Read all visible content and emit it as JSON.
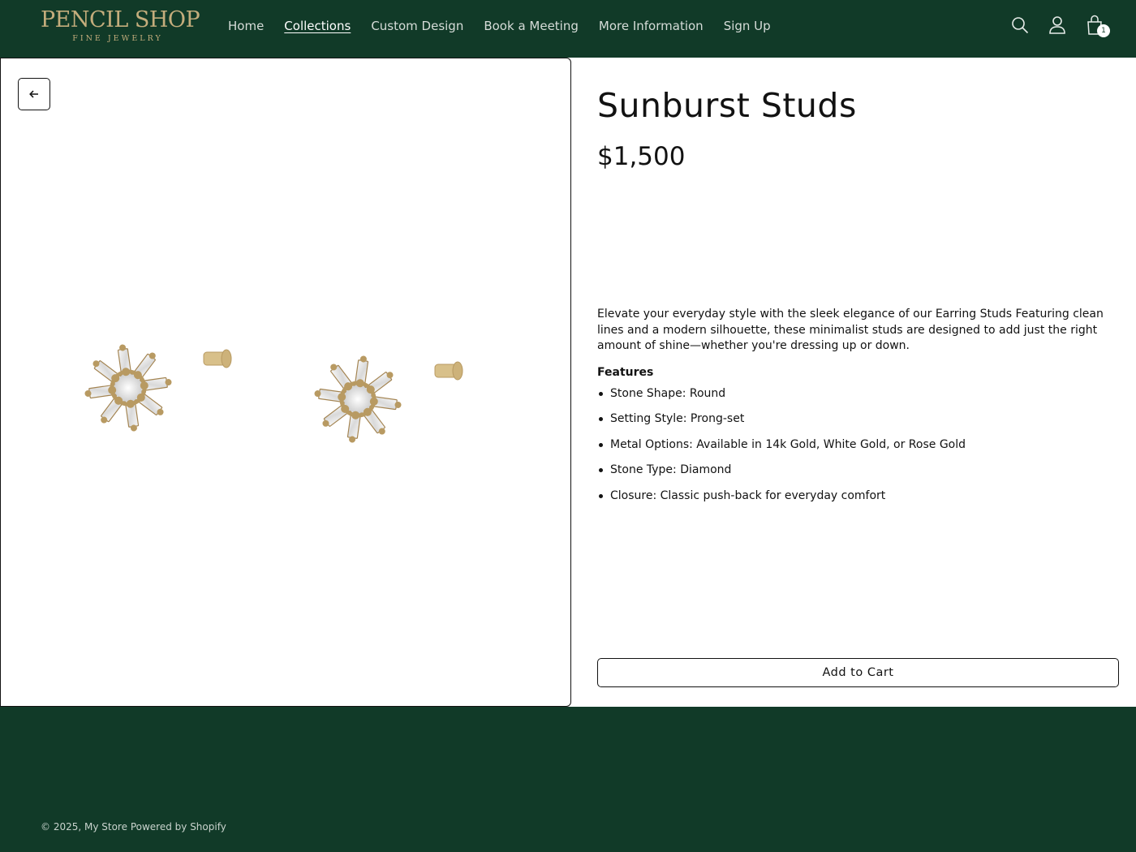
{
  "header": {
    "logo_main": "PENCIL SHOP",
    "logo_sub": "FINE JEWELRY",
    "nav": [
      {
        "label": "Home"
      },
      {
        "label": "Collections"
      },
      {
        "label": "Custom Design"
      },
      {
        "label": "Book a Meeting"
      },
      {
        "label": "More Information"
      },
      {
        "label": "Sign Up"
      }
    ],
    "active_nav": "Collections",
    "icons": [
      "search-icon",
      "account-icon",
      "cart-icon"
    ],
    "cart_count": "1"
  },
  "product": {
    "title": "Sunburst Studs",
    "price": "$1,500",
    "description": "Elevate your everyday style with the sleek elegance of our Earring Studs Featuring clean lines and a modern silhouette, these minimalist studs are designed to add just the right amount of shine—whether you're dressing up or down.",
    "features_heading": "Features",
    "features": [
      "Stone Shape: Round",
      "Setting Style: Prong-set",
      "Metal Options: Available in 14k Gold, White Gold, or Rose Gold",
      "Stone Type: Diamond",
      "Closure: Classic push-back for everyday comfort"
    ],
    "add_to_cart": "Add to Cart"
  },
  "footer": {
    "copyright": "© 2025,",
    "store_link": "My Store",
    "powered": "Powered by Shopify"
  },
  "colors": {
    "brand_green": "#113a28",
    "gold": "#c4ad7c"
  }
}
